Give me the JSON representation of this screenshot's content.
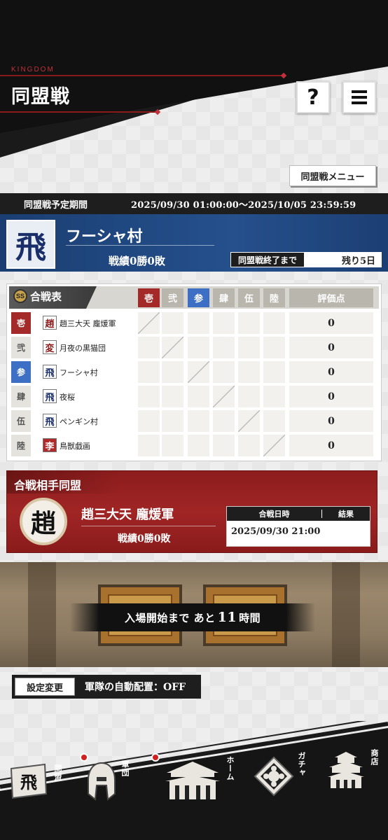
{
  "header": {
    "brand": "KINGDOM",
    "title": "同盟戦",
    "help_label": "?"
  },
  "war_menu_label": "同盟戦メニュー",
  "period": {
    "label": "同盟戦予定期間",
    "value": "2025/09/30 01:00:00～2025/10/05 23:59:59"
  },
  "alliance": {
    "emblem": "飛",
    "name": "フーシャ村",
    "record": "戦績0勝0敗",
    "until_end_label": "同盟戦終了まで",
    "until_end_value": "残り5日"
  },
  "battle_table": {
    "badge": "SS",
    "title": "合戦表",
    "columns": [
      "壱",
      "弐",
      "参",
      "肆",
      "伍",
      "陸"
    ],
    "score_header": "評価点",
    "rows": [
      {
        "num": "壱",
        "emblem": "趙",
        "name": "趙三大天 龐煖軍",
        "score": "0"
      },
      {
        "num": "弐",
        "emblem": "変",
        "name": "月夜の黒猫団",
        "score": "0"
      },
      {
        "num": "参",
        "emblem": "飛",
        "name": "フーシャ村",
        "score": "0"
      },
      {
        "num": "肆",
        "emblem": "飛",
        "name": "夜桜",
        "score": "0"
      },
      {
        "num": "伍",
        "emblem": "飛",
        "name": "ペンギン村",
        "score": "0"
      },
      {
        "num": "陸",
        "emblem": "李",
        "name": "鳥獣戯画",
        "score": "0"
      }
    ]
  },
  "opponent": {
    "title": "合戦相手同盟",
    "emblem": "趙",
    "name": "趙三大天 龐煖軍",
    "record": "戦績0勝0敗",
    "datetime_header": "合戦日時",
    "result_header": "結果",
    "datetime": "2025/09/30 21:00",
    "result": ""
  },
  "entry": {
    "prefix": "入場開始まで あと",
    "hours": "11",
    "suffix": "時間"
  },
  "settings": {
    "button": "設定変更",
    "auto_deploy": "軍隊の自動配置：OFF"
  },
  "nav": [
    {
      "label": "同盟",
      "icon": "alliance-flag-icon"
    },
    {
      "label": "軍団",
      "icon": "helmet-icon"
    },
    {
      "label": "ホーム",
      "icon": "palace-icon"
    },
    {
      "label": "ガチャ",
      "icon": "gacha-crest-icon"
    },
    {
      "label": "商店",
      "icon": "shop-building-icon"
    }
  ],
  "colors": {
    "accent_red": "#a42a2a",
    "accent_blue": "#3d6fc5",
    "panel_blue": "#25508c",
    "dark": "#1e1e1e"
  }
}
